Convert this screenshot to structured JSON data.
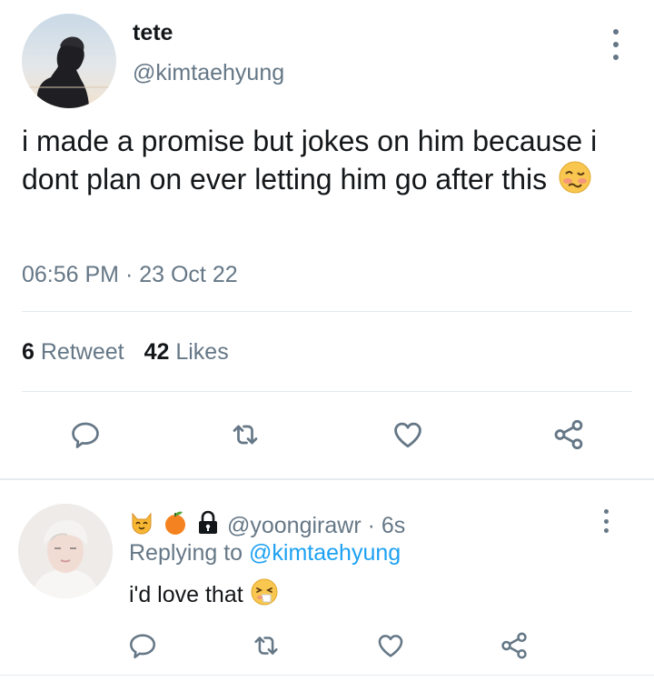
{
  "tweet": {
    "display_name": "tete",
    "handle": "@kimtaehyung",
    "text": "i made a promise but jokes on him because i dont plan on ever letting him go after this",
    "emoji": "woozy-face",
    "timestamp": "06:56 PM · 23 Oct 22",
    "retweet_count": "6",
    "retweet_label": "Retweet",
    "like_count": "42",
    "like_label": "Likes",
    "actions": [
      "reply-icon",
      "retweet-icon",
      "like-icon",
      "share-icon"
    ]
  },
  "reply": {
    "badges": [
      "cat-face-icon",
      "tangerine-icon",
      "lock-icon"
    ],
    "handle": "@yoongirawr",
    "time": "· 6s",
    "replying_prefix": "Replying to",
    "replying_to": "@kimtaehyung",
    "text": "i'd love that",
    "emoji": "sneezing-face",
    "actions": [
      "reply-icon",
      "retweet-icon",
      "like-icon",
      "share-icon"
    ]
  },
  "colors": {
    "text_primary": "#14171a",
    "text_secondary": "#657786",
    "accent": "#1da1f2",
    "divider": "#e1e8ed"
  }
}
